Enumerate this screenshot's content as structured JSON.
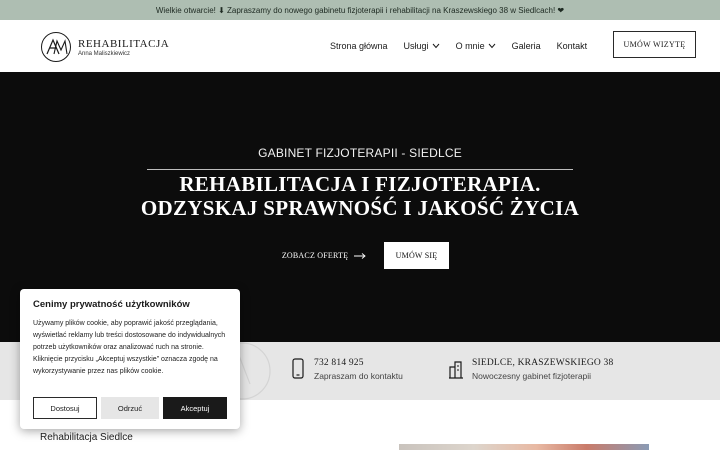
{
  "announcement": {
    "text": "Wielkie otwarcie! ⬇ Zapraszamy do nowego gabinetu fizjoterapii i rehabilitacji na Kraszewskiego 38 w Siedlcach! ❤"
  },
  "logo": {
    "title": "REHABILITACJA",
    "subtitle": "Anna Maliszkiewicz"
  },
  "nav": {
    "items": [
      {
        "label": "Strona główna",
        "dropdown": false
      },
      {
        "label": "Usługi",
        "dropdown": true
      },
      {
        "label": "O mnie",
        "dropdown": true
      },
      {
        "label": "Galeria",
        "dropdown": false
      },
      {
        "label": "Kontakt",
        "dropdown": false
      }
    ],
    "cta_label": "UMÓW WIZYTĘ"
  },
  "hero": {
    "kicker": "GABINET FIZJOTERAPII - SIEDLCE",
    "title_line1": "REHABILITACJA I FIZJOTERAPIA.",
    "title_line2": "ODZYSKAJ SPRAWNOŚĆ I JAKOŚĆ ŻYCIA",
    "offer_button": "ZOBACZ OFERTĘ",
    "book_button": "UMÓW SIĘ"
  },
  "info": {
    "phone": {
      "main": "732 814 925",
      "sub": "Zapraszam do kontaktu",
      "icon": "phone-icon"
    },
    "address": {
      "main": "SIEDLCE, KRASZEWSKIEGO 38",
      "sub": "Nowoczesny gabinet fizjoterapii",
      "icon": "building-icon"
    }
  },
  "below": {
    "title": "Rehabilitacja Siedlce"
  },
  "cookie": {
    "title": "Cenimy prywatność użytkowników",
    "text": "Używamy plików cookie, aby poprawić jakość przeglądania, wyświetlać reklamy lub treści dostosowane do indywidualnych potrzeb użytkowników oraz analizować ruch na stronie. Kliknięcie przycisku „Akceptuj wszystkie” oznacza zgodę na wykorzystywanie przez nas plików cookie.",
    "reject": "Dostosuj",
    "customize": "Odrzuć",
    "accept": "Akceptuj"
  },
  "colors": {
    "announcement_bg": "#aebeb2",
    "hero_bg": "#0c0c0c",
    "infobar_bg": "#e6e6e6",
    "accept_bg": "#1a1a1a"
  }
}
